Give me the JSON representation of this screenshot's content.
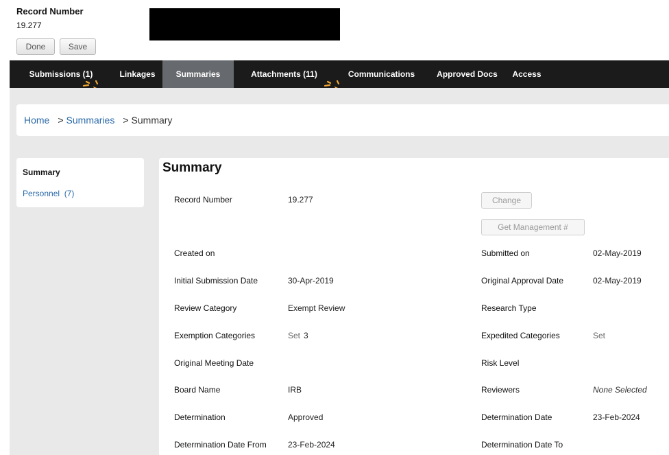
{
  "header": {
    "record_label": "Record Number",
    "record_value": "19.277",
    "done_label": "Done",
    "save_label": "Save"
  },
  "nav": {
    "tabs": [
      {
        "label": "Submissions (1)",
        "active": false
      },
      {
        "label": "Linkages",
        "active": false
      },
      {
        "label": "Summaries",
        "active": true
      },
      {
        "label": "Attachments (11)",
        "active": false
      },
      {
        "label": "Communications",
        "active": false
      },
      {
        "label": "Approved Docs",
        "active": false
      },
      {
        "label": "Access",
        "active": false
      }
    ]
  },
  "breadcrumb": {
    "home": "Home",
    "sep1": ">",
    "summaries": "Summaries",
    "sep2": ">",
    "current": "Summary"
  },
  "sidebar": {
    "summary": "Summary",
    "personnel": "Personnel",
    "personnel_count": "(7)"
  },
  "main": {
    "title": "Summary",
    "change_button": "Change",
    "get_mgmt_button": "Get Management #",
    "fields": {
      "record_number": {
        "label": "Record Number",
        "value": "19.277"
      },
      "created_on": {
        "label": "Created on",
        "value": ""
      },
      "initial_submission_date": {
        "label": "Initial Submission Date",
        "value": "30-Apr-2019"
      },
      "review_category": {
        "label": "Review Category",
        "value": "Exempt Review"
      },
      "exemption_categories": {
        "label": "Exemption Categories",
        "set": "Set",
        "count": "3"
      },
      "original_meeting_date": {
        "label": "Original Meeting Date",
        "value": ""
      },
      "board_name": {
        "label": "Board Name",
        "value": "IRB"
      },
      "determination": {
        "label": "Determination",
        "value": "Approved"
      },
      "determination_date_from": {
        "label": "Determination Date From",
        "value": "23-Feb-2024"
      },
      "submitted_on": {
        "label": "Submitted on",
        "value": "02-May-2019"
      },
      "original_approval_date": {
        "label": "Original Approval Date",
        "value": "02-May-2019"
      },
      "research_type": {
        "label": "Research Type",
        "value": ""
      },
      "expedited_categories": {
        "label": "Expedited Categories",
        "value": "Set"
      },
      "risk_level": {
        "label": "Risk Level",
        "value": ""
      },
      "reviewers": {
        "label": "Reviewers",
        "value": "None Selected"
      },
      "determination_date": {
        "label": "Determination Date",
        "value": "23-Feb-2024"
      },
      "determination_date_to": {
        "label": "Determination Date To",
        "value": ""
      }
    }
  },
  "colors": {
    "nav_bg": "#1b1b1b",
    "nav_active": "#666a6e",
    "link": "#2a6aa8",
    "pointer": "#f0a830"
  },
  "icons": [
    "pointer-arrow-icon",
    "pointer-arrow-icon"
  ]
}
